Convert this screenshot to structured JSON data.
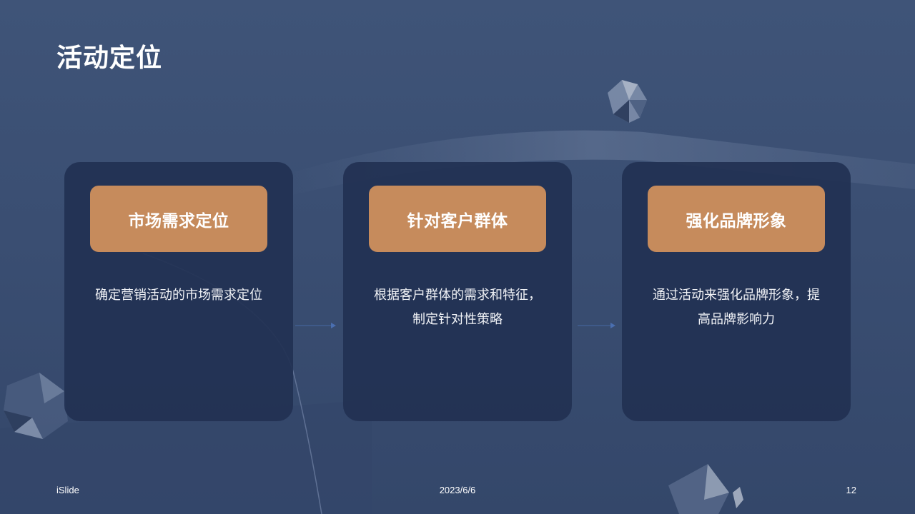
{
  "slide": {
    "title": "活动定位",
    "cards": [
      {
        "header": "市场需求定位",
        "body": "确定营销活动的市场需求定位"
      },
      {
        "header": "针对客户群体",
        "body": "根据客户群体的需求和特征，制定针对性策略"
      },
      {
        "header": "强化品牌形象",
        "body": "通过活动来强化品牌形象，提高品牌影响力"
      }
    ],
    "footer": {
      "brand": "iSlide",
      "date": "2023/6/6",
      "page_number": "12"
    }
  },
  "colors": {
    "background": "#3f5478",
    "card": "#223152",
    "card_header": "#c68b5c",
    "text": "#ffffff"
  }
}
